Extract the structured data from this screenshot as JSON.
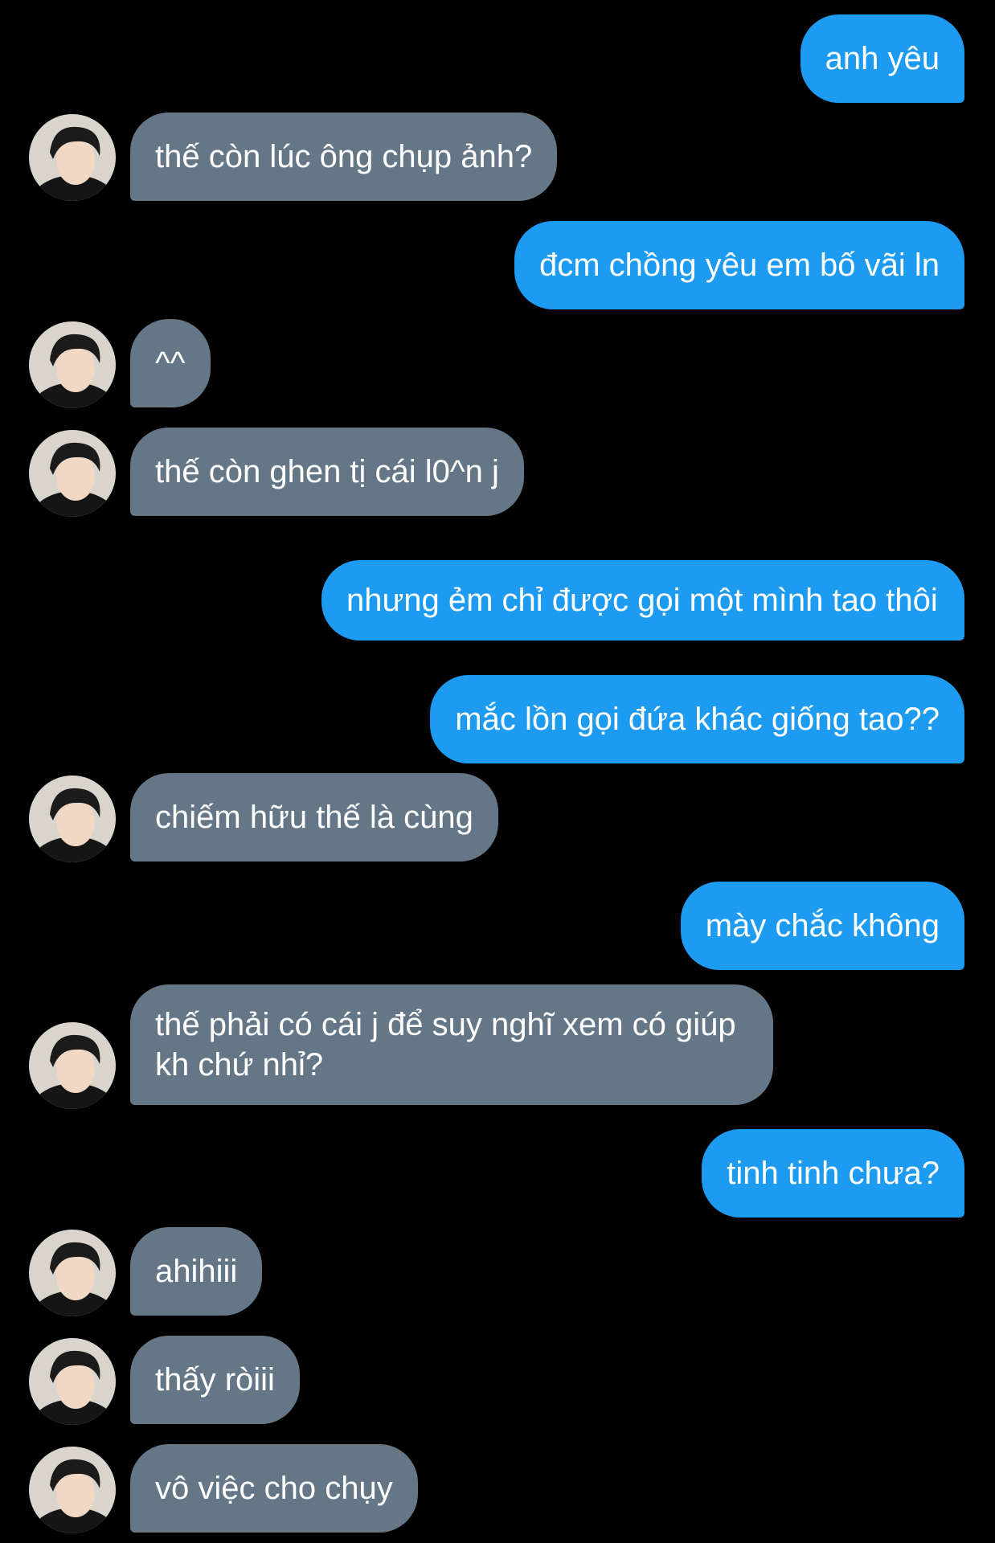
{
  "conversation": {
    "messages": [
      {
        "side": "out",
        "text": "anh yêu"
      },
      {
        "side": "in",
        "text": "thế còn lúc ông chụp ảnh?"
      },
      {
        "side": "out",
        "text": "đcm chồng yêu em bố vãi ln"
      },
      {
        "side": "in",
        "text": "^^"
      },
      {
        "side": "in",
        "text": "thế còn ghen tị cái l0^n j"
      },
      {
        "side": "out",
        "text": "nhưng ẻm chỉ được gọi một mình tao thôi"
      },
      {
        "side": "out",
        "text": "mắc lồn gọi đứa khác giống tao??"
      },
      {
        "side": "in",
        "text": "chiếm hữu thế là cùng"
      },
      {
        "side": "out",
        "text": "mày chắc không"
      },
      {
        "side": "in",
        "text": "thế phải có cái j để suy nghĩ xem có giúp kh chứ nhỉ?"
      },
      {
        "side": "out",
        "text": "tinh tinh chưa?"
      },
      {
        "side": "in",
        "text": "ahihiii"
      },
      {
        "side": "in",
        "text": "thấy ròiii"
      },
      {
        "side": "in",
        "text": "vô việc cho chụy"
      }
    ]
  },
  "colors": {
    "background": "#000000",
    "outgoing_bubble": "#1d9bf0",
    "incoming_bubble": "#657786",
    "text": "#ffffff"
  },
  "icons": {
    "avatar": "user-avatar-photo"
  }
}
